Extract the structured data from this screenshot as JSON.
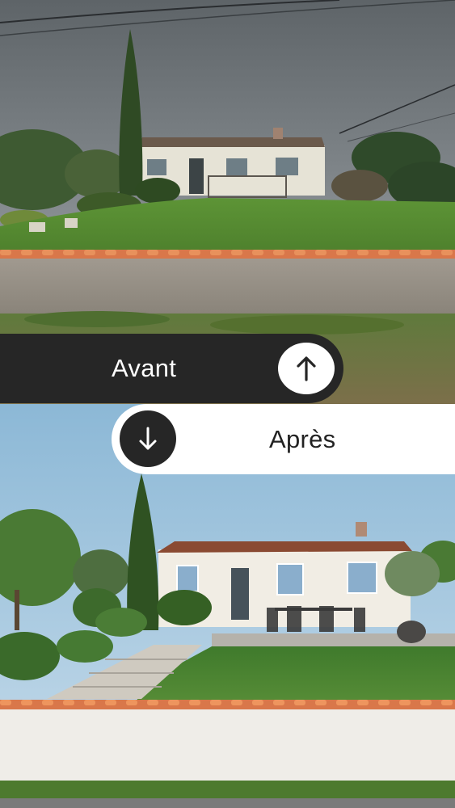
{
  "labels": {
    "before": "Avant",
    "after": "Après"
  },
  "icons": {
    "before": "arrow-up-icon",
    "after": "arrow-down-icon"
  },
  "colors": {
    "bar_dark": "#262626",
    "bar_light": "#ffffff",
    "roof_tile": "#d9774a"
  }
}
